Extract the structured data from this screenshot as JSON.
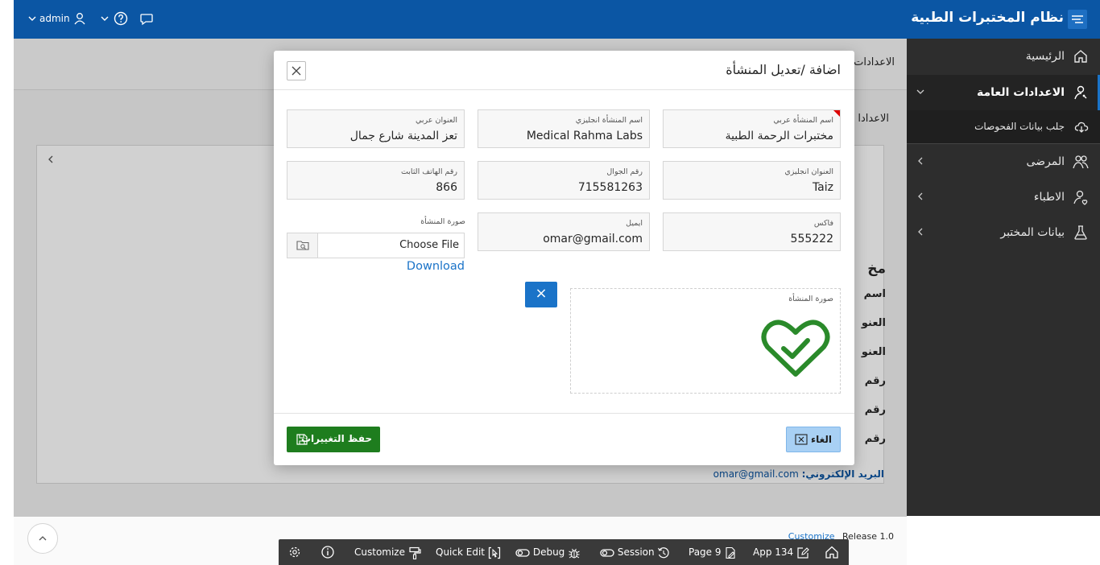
{
  "app": {
    "title": "نظام المختبرات الطبية"
  },
  "header": {
    "user": "admin"
  },
  "sidebar": {
    "items": [
      {
        "label": "الرئيسية"
      },
      {
        "label": "الاعدادات العامة"
      },
      {
        "label": "جلب بيانات الفحوصات"
      },
      {
        "label": "المرضى"
      },
      {
        "label": "الاطباء"
      },
      {
        "label": "بيانات المختبر"
      }
    ]
  },
  "page": {
    "breadcrumb": "الاعدادات",
    "region_title": "الاعدادا",
    "background_labels": [
      "مخ",
      "اسم",
      "العنو",
      "العنو",
      "رقم",
      "رقم",
      "رقم"
    ],
    "email_label": "البريد الإلكتروني:",
    "email_value": "omar@gmail.com"
  },
  "dialog": {
    "title": "اضافة /تعديل المنشأة",
    "fields": {
      "name_ar": {
        "label": "اسم المنشأة عربي",
        "value": "مختبرات الرحمة  الطبية"
      },
      "name_en": {
        "label": "اسم المنشأة انجليزي",
        "value": "Medical Rahma Labs"
      },
      "address_ar": {
        "label": "العنوان عربي",
        "value": "تعز المدينة شارع جمال"
      },
      "address_en": {
        "label": "العنوان انجليزي",
        "value": "Taiz"
      },
      "mobile": {
        "label": "رقم الجوال",
        "value": "715581263"
      },
      "phone": {
        "label": "رقم الهاتف الثابت",
        "value": "866"
      },
      "fax": {
        "label": "فاكس",
        "value": "555222"
      },
      "email": {
        "label": "ايميل",
        "value": "omar@gmail.com"
      },
      "image_upload": {
        "label": "صورة المنشأة",
        "button": "Choose File",
        "download": "Download"
      }
    },
    "image_display": {
      "label": "صورة المنشأة",
      "icon": "heart-check-icon"
    },
    "remove_image_button": "×",
    "save_button": "حفظ التغييرات",
    "cancel_button": "الغاء"
  },
  "footer": {
    "customize": "Customize",
    "release": "Release 1.0"
  },
  "dev_toolbar": {
    "customize": "Customize",
    "quick_edit": "Quick Edit",
    "debug": "Debug",
    "session": "Session",
    "page": "Page 9",
    "app": "App 134"
  },
  "colors": {
    "header": "#0b56a4",
    "sidebar": "#2d2d2d",
    "save": "#1e7d1e",
    "accent": "#1a73c8",
    "check_icon": "#2a8a2a"
  }
}
